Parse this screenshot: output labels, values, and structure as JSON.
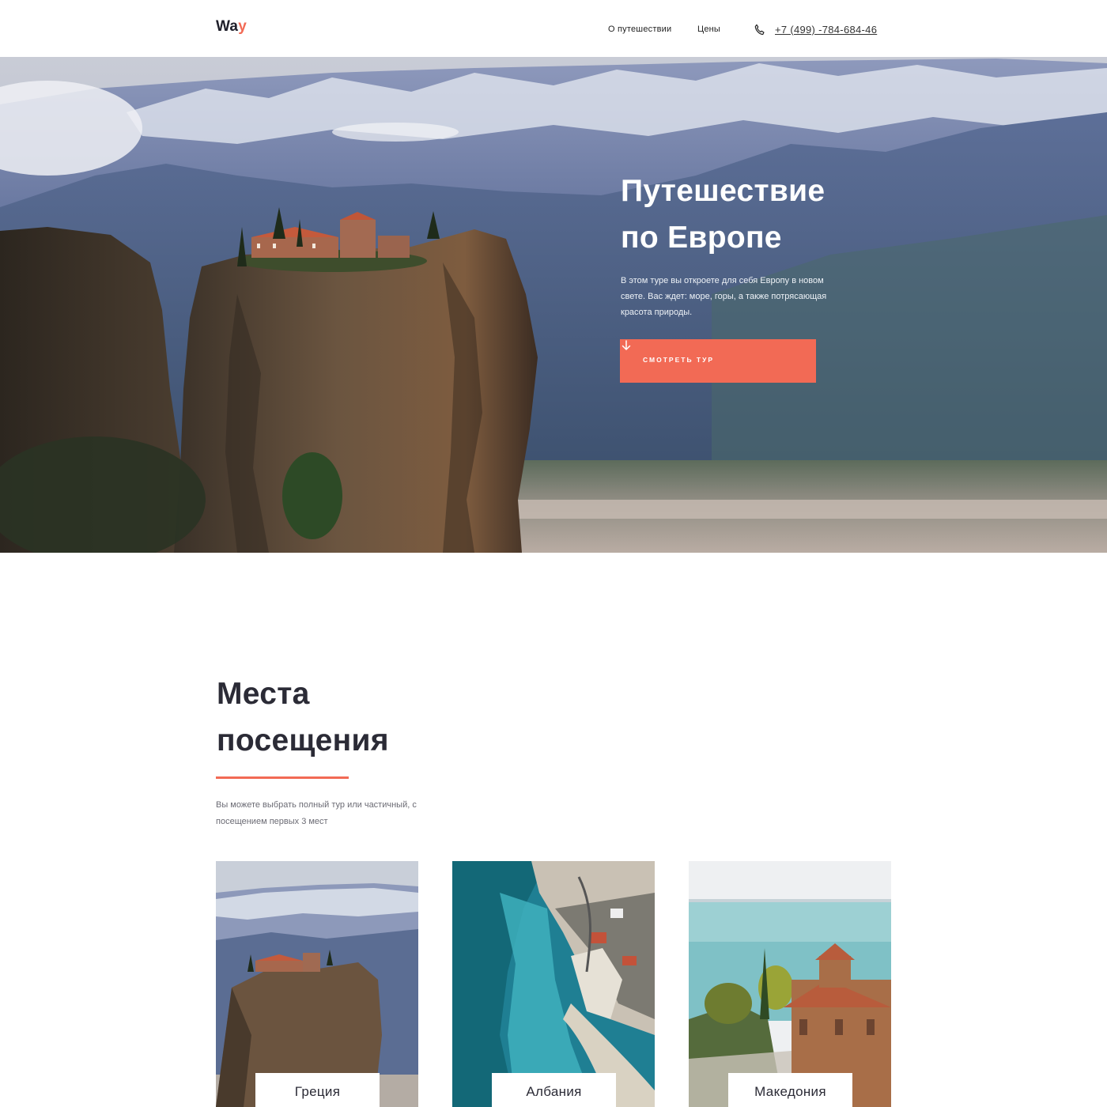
{
  "header": {
    "logo_main": "Wa",
    "logo_accent": "y",
    "nav": [
      {
        "label": "О путешествии"
      },
      {
        "label": "Цены"
      }
    ],
    "phone_icon": "phone-icon",
    "phone": "+7 (499) -784-684-46"
  },
  "hero": {
    "title_line1": "Путешествие",
    "title_line2": "по Европе",
    "description": "В этом туре вы откроете для себя Европу в новом свете. Вас ждет: море, горы, а также потрясающая красота природы.",
    "button_label": "СМОТРЕТЬ ТУР",
    "button_icon": "arrow-down-icon"
  },
  "places": {
    "title_line1": "Места",
    "title_line2": "посещения",
    "description": "Вы можете выбрать полный тур или частичный, с посещением первых 3 мест",
    "cards": [
      {
        "label": "Греция"
      },
      {
        "label": "Албания"
      },
      {
        "label": "Македония"
      }
    ]
  },
  "colors": {
    "accent": "#f26a55",
    "text_dark": "#2b2b36",
    "text_muted": "#6b6b74"
  }
}
